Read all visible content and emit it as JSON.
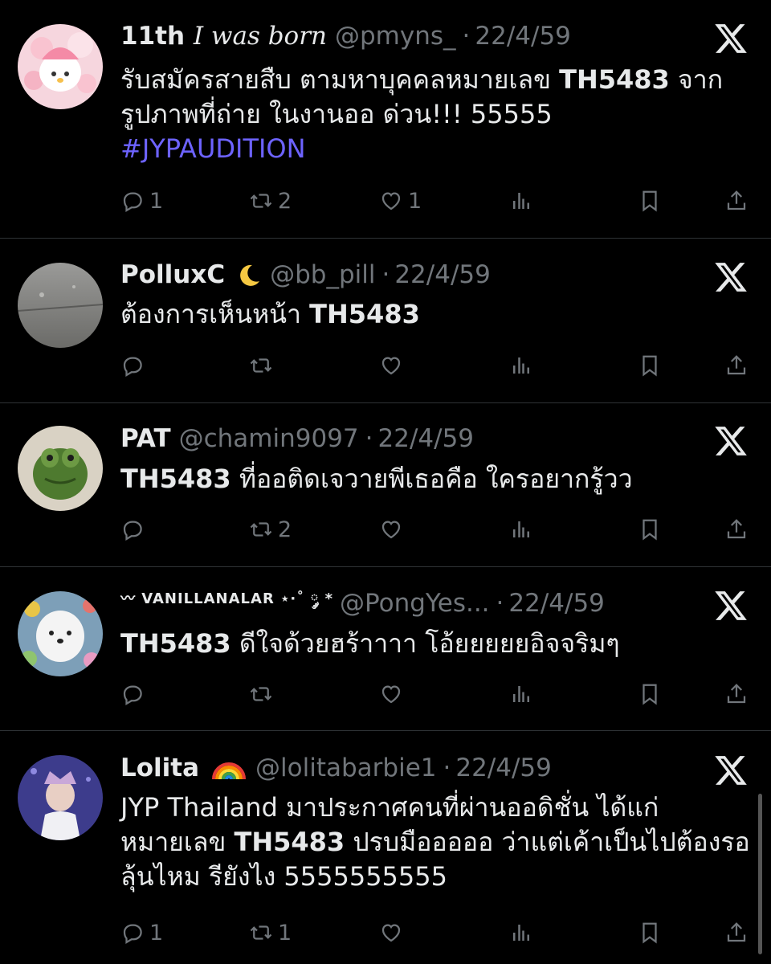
{
  "tweets": [
    {
      "name": "11th",
      "name_italic": "I was born",
      "handle": "@pmyns_",
      "dot": "·",
      "date": "22/4/59",
      "text_pre": "รับสมัครสายสืบ ตามหาบุคคลหมายเลข ",
      "text_bold": "TH5483",
      "text_post": " จากรูปภาพที่ถ่าย ในงานออ ด่วน!!! 55555",
      "hashtag": "#JYPAUDITION",
      "replies": "1",
      "retweets": "2",
      "likes": "1"
    },
    {
      "name": "PolluxC",
      "handle": "@bb_pill",
      "dot": "·",
      "date": "22/4/59",
      "text_pre": "ต้องการเห็นหน้า  ",
      "text_bold": "TH5483",
      "replies": "",
      "retweets": "",
      "likes": ""
    },
    {
      "name": "PAT",
      "handle": "@chamin9097",
      "dot": "·",
      "date": "22/4/59",
      "text_bold": "TH5483",
      "text_post": " ที่ออติดเจวายพีเธอคือ ใครอยากรู้วว",
      "replies": "",
      "retweets": "2",
      "likes": ""
    },
    {
      "name_prefix": "〰",
      "name": "VANILLANALAR",
      "name_suffix": "⋆·˚ ༘ *",
      "handle": "@PongYes...",
      "dot": "·",
      "date": "22/4/59",
      "text_bold": "TH5483",
      "text_post": " ดีใจด้วยฮร้าาาา โอ้ยยยยยอิจจริมๆ",
      "replies": "",
      "retweets": "",
      "likes": ""
    },
    {
      "name": "Lolita",
      "handle": "@lolitabarbie1",
      "dot": "·",
      "date": "22/4/59",
      "text_pre": "JYP Thailand มาประกาศคนที่ผ่านออดิชั่น ได้แก่หมายเลข ",
      "text_bold": "TH5483",
      "text_post": " ปรบมือออออ ว่าแต่เค้าเป็นไปต้องรอลุ้นไหม รียังไง 5555555555",
      "replies": "1",
      "retweets": "1",
      "likes": ""
    }
  ],
  "colors": {
    "background": "#000000",
    "text": "#e7e9ea",
    "secondary": "#71767b",
    "hashtag": "#6d63ff",
    "divider": "#2f3336"
  },
  "icons": [
    "x-logo-icon",
    "reply-icon",
    "retweet-icon",
    "like-icon",
    "views-icon",
    "bookmark-icon",
    "share-icon",
    "moon-emoji-icon",
    "rainbow-emoji-icon"
  ]
}
